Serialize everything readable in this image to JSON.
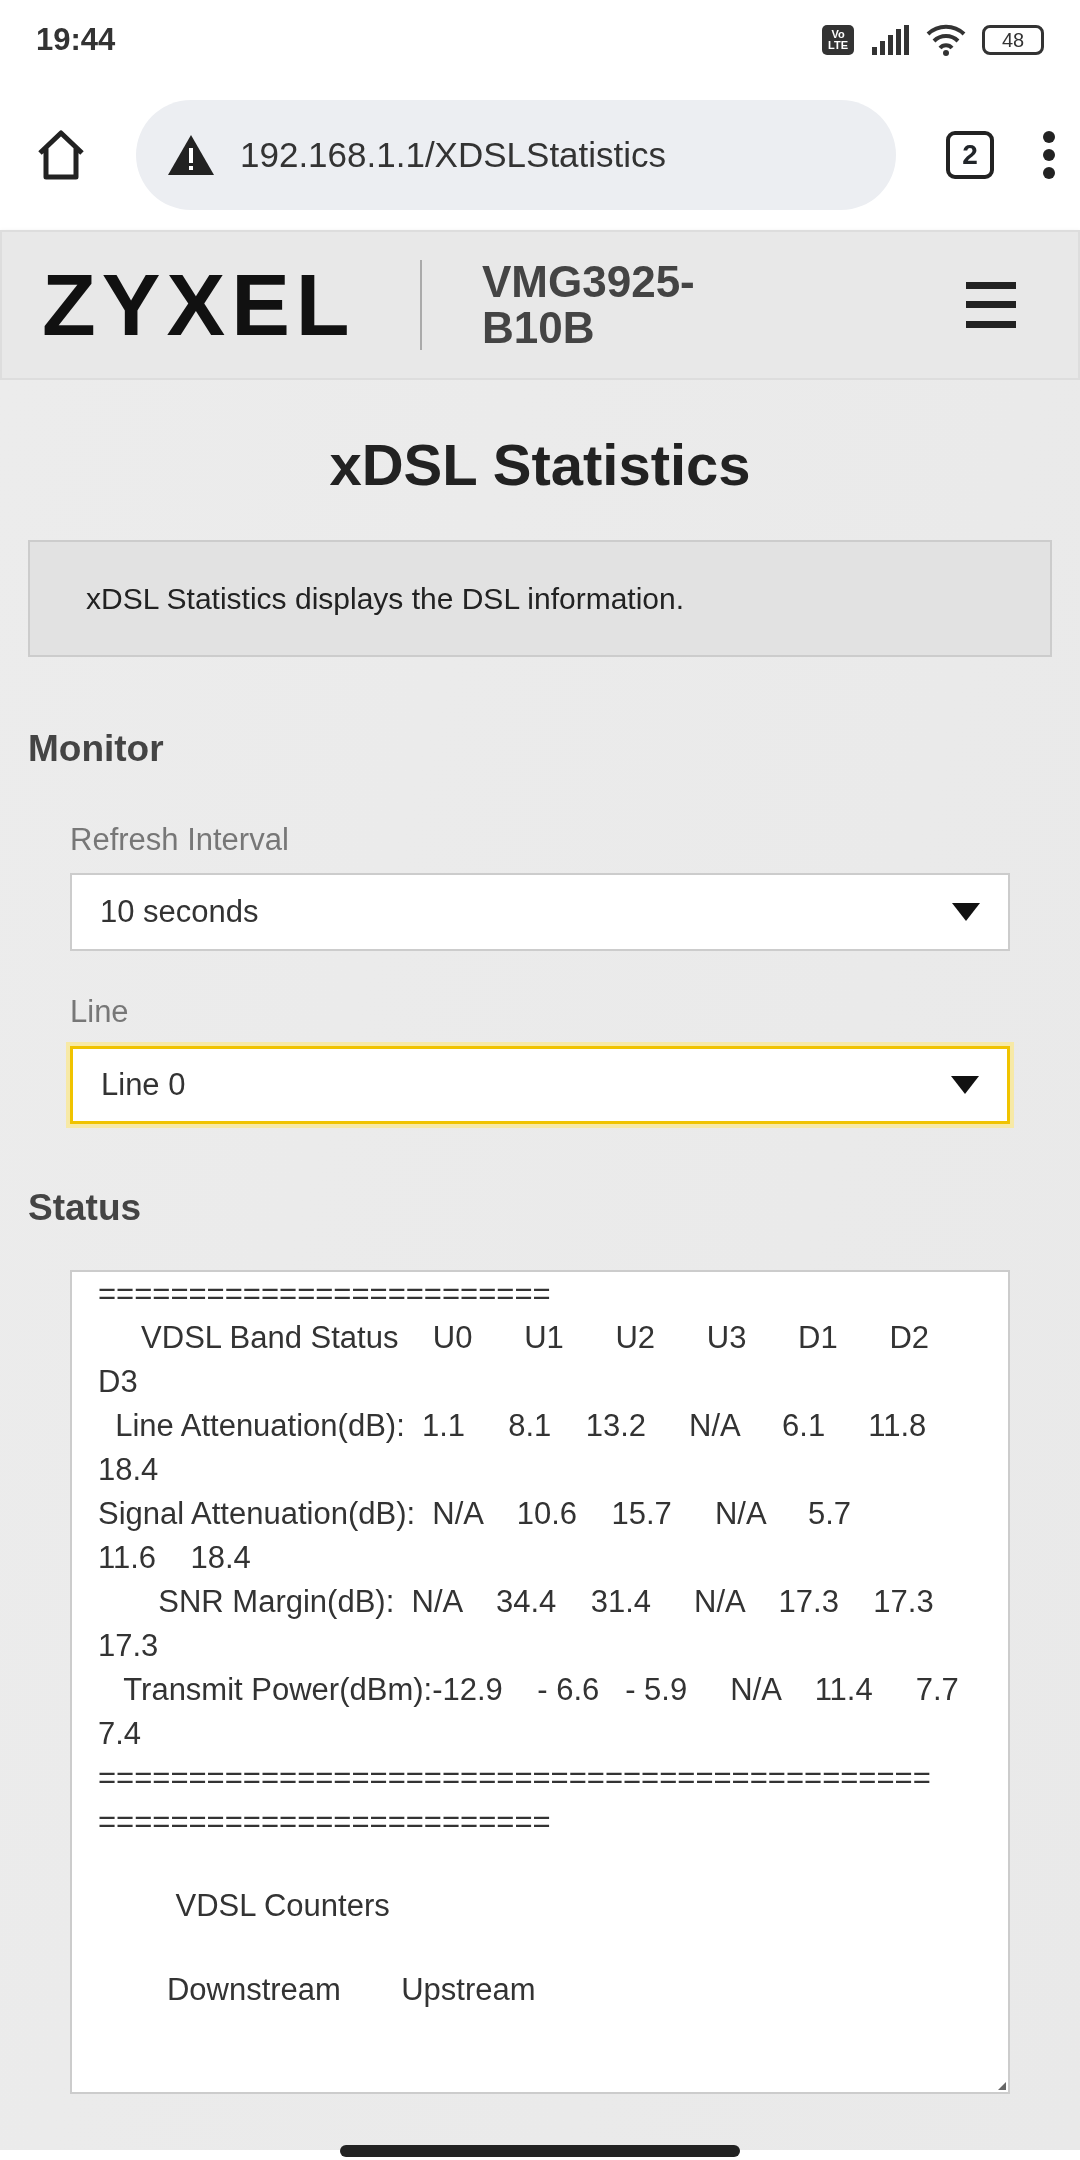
{
  "status_bar": {
    "time": "19:44",
    "volte": "Vo LTE",
    "battery": "48"
  },
  "browser": {
    "url": "192.168.1.1/XDSLStatistics",
    "tab_count": "2"
  },
  "header": {
    "logo": "ZYXEL",
    "model": "VMG3925-\nB10B"
  },
  "page": {
    "title": "xDSL Statistics",
    "description": "xDSL Statistics displays the DSL information."
  },
  "monitor": {
    "heading": "Monitor",
    "fields": [
      {
        "label": "Refresh Interval",
        "value": "10 seconds",
        "focused": false
      },
      {
        "label": "Line",
        "value": "Line 0",
        "focused": true
      }
    ]
  },
  "status": {
    "heading": "Status",
    "lines": [
      {
        "text": "========================="
      },
      {
        "text": "     VDSL Band Status    U0      U1      U2      U3      D1      D2"
      },
      {
        "text": "D3"
      },
      {
        "text": "  Line Attenuation(dB):  1.1     8.1    13.2     N/A     6.1     11.8"
      },
      {
        "text": "18.4"
      },
      {
        "text": "Signal Attenuation(dB):  N/A    10.6    15.7     N/A     5.7"
      },
      {
        "text": "11.6    18.4"
      },
      {
        "text": "       SNR Margin(dB):  N/A    34.4    31.4     N/A    17.3    17.3"
      },
      {
        "text": "17.3"
      },
      {
        "text": "   Transmit Power(dBm):-12.9    - 6.6   - 5.9     N/A    11.4     7.7"
      },
      {
        "text": "7.4"
      },
      {
        "text": "=============================================="
      },
      {
        "text": "========================="
      },
      {
        "text": "         VDSL Counters",
        "gap_before": true
      },
      {
        "text": "        Downstream       Upstream",
        "gap_before": true
      }
    ]
  }
}
